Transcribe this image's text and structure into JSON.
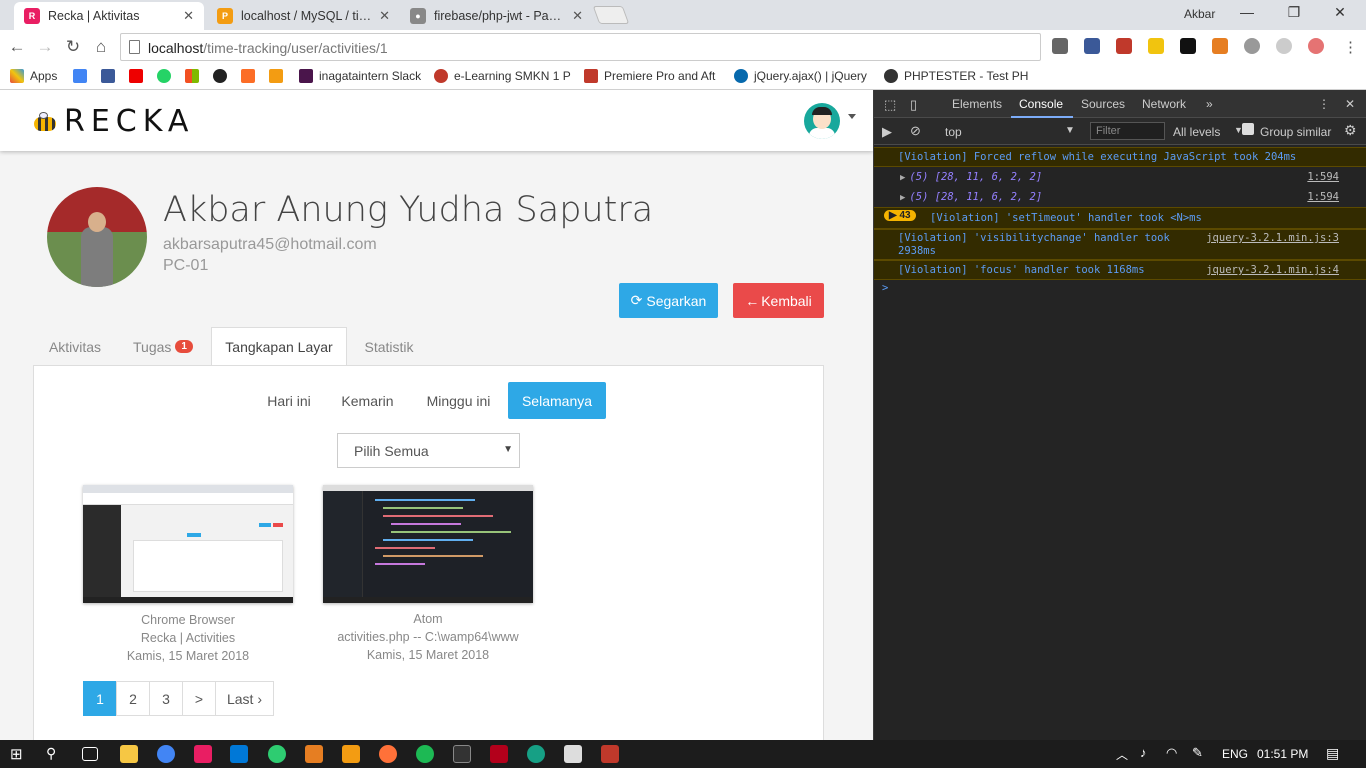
{
  "browser": {
    "tabs": [
      {
        "title": "Recka | Aktivitas",
        "active": true
      },
      {
        "title": "localhost / MySQL / time",
        "active": false
      },
      {
        "title": "firebase/php-jwt - Packa",
        "active": false
      }
    ],
    "window_user": "Akbar",
    "url_host": "localhost",
    "url_path": "/time-tracking/user/activities/1",
    "bookmarks": [
      "Apps",
      "inagataintern Slack",
      "e-Learning SMKN 1 P",
      "Premiere Pro and Aft",
      "jQuery.ajax() | jQuery",
      "PHPTESTER - Test PH"
    ]
  },
  "app": {
    "logo": "RECKA",
    "profile": {
      "name": "Akbar Anung Yudha Saputra",
      "email": "akbarsaputra45@hotmail.com",
      "pc": "PC-01"
    },
    "buttons": {
      "refresh": "Segarkan",
      "back": "Kembali"
    },
    "tabs": [
      {
        "label": "Aktivitas"
      },
      {
        "label": "Tugas",
        "badge": "1"
      },
      {
        "label": "Tangkapan Layar",
        "active": true
      },
      {
        "label": "Statistik"
      }
    ],
    "filters": [
      "Hari ini",
      "Kemarin",
      "Minggu ini",
      "Selamanya"
    ],
    "active_filter": "Selamanya",
    "select_value": "Pilih Semua",
    "screenshots": [
      {
        "app": "Chrome Browser",
        "title": "Recka | Activities",
        "date": "Kamis, 15 Maret 2018"
      },
      {
        "app": "Atom",
        "title": "activities.php -- C:\\wamp64\\www",
        "date": "Kamis, 15 Maret 2018"
      }
    ],
    "pagination": [
      "1",
      "2",
      "3",
      ">",
      "Last ›"
    ]
  },
  "devtools": {
    "tabs": [
      "Elements",
      "Console",
      "Sources",
      "Network"
    ],
    "context": "top",
    "filter_placeholder": "Filter",
    "levels": "All levels",
    "group_similar": "Group similar",
    "console": [
      {
        "type": "warn",
        "text": "[Violation] Forced reflow while executing JavaScript took 204ms"
      },
      {
        "type": "array",
        "text": "(5) [28, 11, 6, 2, 2]",
        "src": "1:594"
      },
      {
        "type": "array",
        "text": "(5) [28, 11, 6, 2, 2]",
        "src": "1:594"
      },
      {
        "type": "warn",
        "count": "43",
        "text": "[Violation] 'setTimeout' handler took <N>ms"
      },
      {
        "type": "warn",
        "text": "[Violation] 'visibilitychange' handler took",
        "text2": "2938ms",
        "src": "jquery-3.2.1.min.js:3"
      },
      {
        "type": "warn",
        "text": "[Violation] 'focus' handler took 1168ms",
        "src": "jquery-3.2.1.min.js:4"
      }
    ],
    "prompt": ">"
  },
  "taskbar": {
    "lang": "ENG",
    "time": "01:51 PM"
  }
}
